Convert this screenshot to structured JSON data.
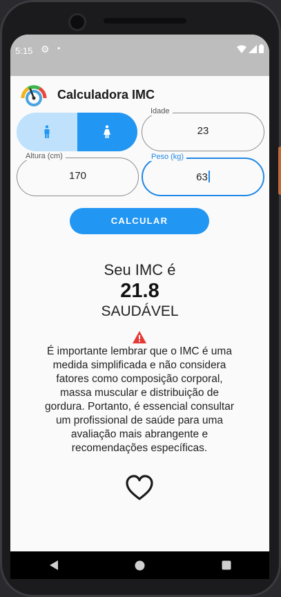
{
  "status": {
    "time": "5:15"
  },
  "app": {
    "title": "Calculadora IMC"
  },
  "form": {
    "idade": {
      "label": "Idade",
      "value": "23"
    },
    "altura": {
      "label": "Altura (cm)",
      "value": "170"
    },
    "peso": {
      "label": "Peso (kg)",
      "value": "63"
    },
    "gender_selected": "female",
    "calcular_label": "CALCULAR"
  },
  "result": {
    "label": "Seu IMC é",
    "value": "21.8",
    "status": "SAUDÁVEL"
  },
  "disclaimer": "É importante lembrar que o IMC é uma medida simplificada e não considera fatores como composição corporal, massa muscular e distribuição de gordura. Portanto, é essencial consultar um profissional de saúde para uma avaliação mais abrangente e recomendações específicas.",
  "colors": {
    "accent": "#2196f3",
    "accent_light": "#bfe1fb",
    "warning": "#e53935",
    "status_bar": "#bdbdbd"
  }
}
